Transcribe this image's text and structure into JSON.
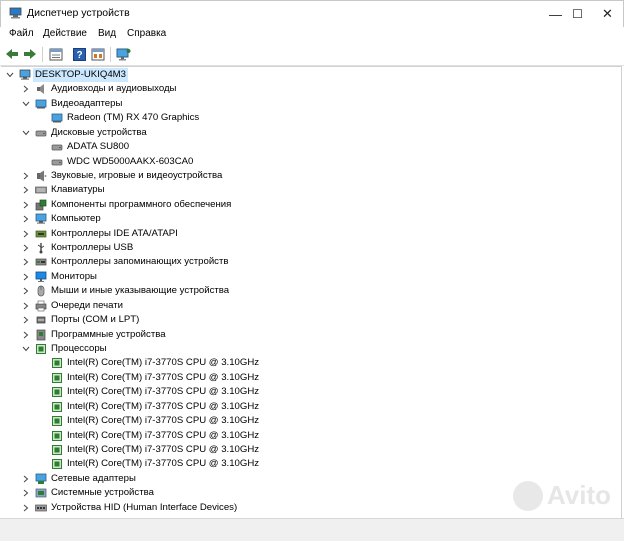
{
  "window": {
    "title": "Диспетчер устройств",
    "controls": {
      "minimize": "—",
      "maximize": "☐",
      "close": "✕"
    }
  },
  "menu": [
    "Файл",
    "Действие",
    "Вид",
    "Справка"
  ],
  "toolbar": [
    "back-arrow-icon",
    "forward-arrow-icon",
    "properties-icon",
    "help-icon",
    "view-icon",
    "monitor-scan-icon"
  ],
  "tree": {
    "root": "DESKTOP-UKIQ4M3",
    "items": [
      {
        "label": "Аудиовходы и аудиовыходы",
        "icon": "speaker-icon",
        "level": 1,
        "state": "collapsed"
      },
      {
        "label": "Видеоадаптеры",
        "icon": "display-adapter-icon",
        "level": 1,
        "state": "expanded"
      },
      {
        "label": "Radeon (TM) RX 470 Graphics",
        "icon": "display-adapter-icon",
        "level": 2,
        "state": "leaf"
      },
      {
        "label": "Дисковые устройства",
        "icon": "disk-drive-icon",
        "level": 1,
        "state": "expanded"
      },
      {
        "label": "ADATA SU800",
        "icon": "disk-drive-icon",
        "level": 2,
        "state": "leaf"
      },
      {
        "label": "WDC WD5000AAKX-603CA0",
        "icon": "disk-drive-icon",
        "level": 2,
        "state": "leaf"
      },
      {
        "label": "Звуковые, игровые и видеоустройства",
        "icon": "sound-icon",
        "level": 1,
        "state": "collapsed"
      },
      {
        "label": "Клавиатуры",
        "icon": "keyboard-icon",
        "level": 1,
        "state": "collapsed"
      },
      {
        "label": "Компоненты программного обеспечения",
        "icon": "software-component-icon",
        "level": 1,
        "state": "collapsed"
      },
      {
        "label": "Компьютер",
        "icon": "computer-icon",
        "level": 1,
        "state": "collapsed"
      },
      {
        "label": "Контроллеры IDE ATA/ATAPI",
        "icon": "ide-controller-icon",
        "level": 1,
        "state": "collapsed"
      },
      {
        "label": "Контроллеры USB",
        "icon": "usb-icon",
        "level": 1,
        "state": "collapsed"
      },
      {
        "label": "Контроллеры запоминающих устройств",
        "icon": "storage-controller-icon",
        "level": 1,
        "state": "collapsed"
      },
      {
        "label": "Мониторы",
        "icon": "monitor-icon",
        "level": 1,
        "state": "collapsed"
      },
      {
        "label": "Мыши и иные указывающие устройства",
        "icon": "mouse-icon",
        "level": 1,
        "state": "collapsed"
      },
      {
        "label": "Очереди печати",
        "icon": "printer-icon",
        "level": 1,
        "state": "collapsed"
      },
      {
        "label": "Порты (COM и LPT)",
        "icon": "port-icon",
        "level": 1,
        "state": "collapsed"
      },
      {
        "label": "Программные устройства",
        "icon": "software-device-icon",
        "level": 1,
        "state": "collapsed"
      },
      {
        "label": "Процессоры",
        "icon": "processor-icon",
        "level": 1,
        "state": "expanded"
      },
      {
        "label": "Intel(R) Core(TM) i7-3770S CPU @ 3.10GHz",
        "icon": "processor-icon",
        "level": 2,
        "state": "leaf"
      },
      {
        "label": "Intel(R) Core(TM) i7-3770S CPU @ 3.10GHz",
        "icon": "processor-icon",
        "level": 2,
        "state": "leaf"
      },
      {
        "label": "Intel(R) Core(TM) i7-3770S CPU @ 3.10GHz",
        "icon": "processor-icon",
        "level": 2,
        "state": "leaf"
      },
      {
        "label": "Intel(R) Core(TM) i7-3770S CPU @ 3.10GHz",
        "icon": "processor-icon",
        "level": 2,
        "state": "leaf"
      },
      {
        "label": "Intel(R) Core(TM) i7-3770S CPU @ 3.10GHz",
        "icon": "processor-icon",
        "level": 2,
        "state": "leaf"
      },
      {
        "label": "Intel(R) Core(TM) i7-3770S CPU @ 3.10GHz",
        "icon": "processor-icon",
        "level": 2,
        "state": "leaf"
      },
      {
        "label": "Intel(R) Core(TM) i7-3770S CPU @ 3.10GHz",
        "icon": "processor-icon",
        "level": 2,
        "state": "leaf"
      },
      {
        "label": "Intel(R) Core(TM) i7-3770S CPU @ 3.10GHz",
        "icon": "processor-icon",
        "level": 2,
        "state": "leaf"
      },
      {
        "label": "Сетевые адаптеры",
        "icon": "network-adapter-icon",
        "level": 1,
        "state": "collapsed"
      },
      {
        "label": "Системные устройства",
        "icon": "system-device-icon",
        "level": 1,
        "state": "collapsed"
      },
      {
        "label": "Устройства HID (Human Interface Devices)",
        "icon": "hid-icon",
        "level": 1,
        "state": "collapsed"
      }
    ]
  },
  "watermark": "Avito",
  "colors": {
    "selection": "#cce8ff",
    "processor": "#2e7d32",
    "monitor_blue": "#1e88e5"
  }
}
